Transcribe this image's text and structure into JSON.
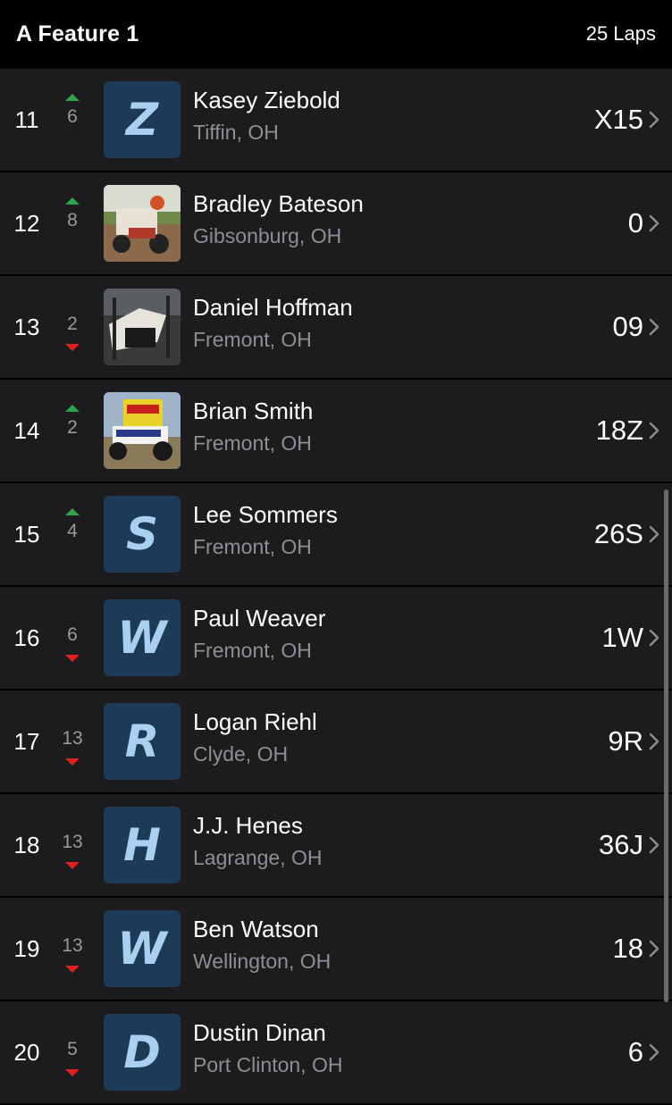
{
  "header": {
    "title": "A Feature 1",
    "laps": "25 Laps"
  },
  "rows": [
    {
      "pos": "11",
      "change": "6",
      "dir": "up",
      "avatar": "letter",
      "letter": "Z",
      "name": "Kasey Ziebold",
      "hometown": "Tiffin, OH",
      "car": "X15"
    },
    {
      "pos": "12",
      "change": "8",
      "dir": "up",
      "avatar": "photo",
      "letter": "",
      "name": "Bradley Bateson",
      "hometown": "Gibsonburg, OH",
      "car": "0"
    },
    {
      "pos": "13",
      "change": "2",
      "dir": "down",
      "avatar": "photo",
      "letter": "",
      "name": "Daniel Hoffman",
      "hometown": "Fremont, OH",
      "car": "09"
    },
    {
      "pos": "14",
      "change": "2",
      "dir": "up",
      "avatar": "photo",
      "letter": "",
      "name": "Brian Smith",
      "hometown": "Fremont, OH",
      "car": "18Z"
    },
    {
      "pos": "15",
      "change": "4",
      "dir": "up",
      "avatar": "letter",
      "letter": "S",
      "name": "Lee Sommers",
      "hometown": "Fremont, OH",
      "car": "26S"
    },
    {
      "pos": "16",
      "change": "6",
      "dir": "down",
      "avatar": "letter",
      "letter": "W",
      "name": "Paul Weaver",
      "hometown": "Fremont, OH",
      "car": "1W"
    },
    {
      "pos": "17",
      "change": "13",
      "dir": "down",
      "avatar": "letter",
      "letter": "R",
      "name": "Logan Riehl",
      "hometown": "Clyde, OH",
      "car": "9R"
    },
    {
      "pos": "18",
      "change": "13",
      "dir": "down",
      "avatar": "letter",
      "letter": "H",
      "name": "J.J. Henes",
      "hometown": "Lagrange, OH",
      "car": "36J"
    },
    {
      "pos": "19",
      "change": "13",
      "dir": "down",
      "avatar": "letter",
      "letter": "W",
      "name": "Ben Watson",
      "hometown": "Wellington, OH",
      "car": "18"
    },
    {
      "pos": "20",
      "change": "5",
      "dir": "down",
      "avatar": "letter",
      "letter": "D",
      "name": "Dustin Dinan",
      "hometown": "Port Clinton, OH",
      "car": "6"
    }
  ],
  "colors": {
    "up": "#30a14e",
    "down": "#e02020",
    "avatar_bg": "#1d3a56",
    "avatar_letter": "#a9d0f0"
  }
}
